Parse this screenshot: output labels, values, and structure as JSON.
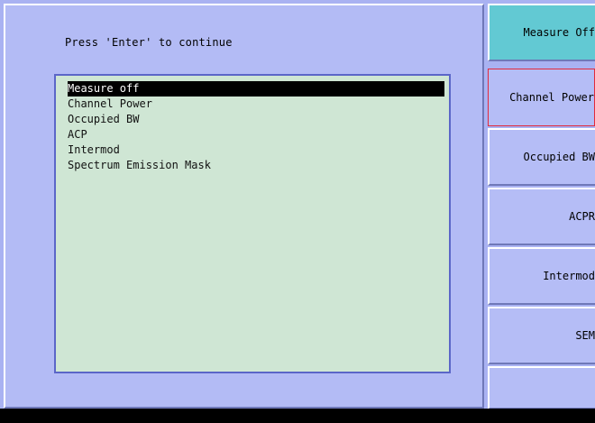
{
  "dialog": {
    "prompt": "Press 'Enter' to continue",
    "measure_list": [
      {
        "label": "Measure off",
        "selected": true
      },
      {
        "label": "Channel Power",
        "selected": false
      },
      {
        "label": "Occupied BW",
        "selected": false
      },
      {
        "label": "ACP",
        "selected": false
      },
      {
        "label": "Intermod",
        "selected": false
      },
      {
        "label": "Spectrum Emission Mask",
        "selected": false
      }
    ]
  },
  "softkeys": [
    {
      "label": "Measure Off",
      "state": "active"
    },
    {
      "label": "Channel Power",
      "state": "focused"
    },
    {
      "label": "Occupied BW",
      "state": "normal"
    },
    {
      "label": "ACPR",
      "state": "normal"
    },
    {
      "label": "Intermod",
      "state": "normal"
    },
    {
      "label": "SEM",
      "state": "normal"
    },
    {
      "label": "",
      "state": "blank"
    }
  ],
  "colors": {
    "background": "#a9b2f2",
    "list_background": "#cfe6d4",
    "active_softkey": "#62c9d3",
    "focus_outline": "#e22a3c"
  }
}
